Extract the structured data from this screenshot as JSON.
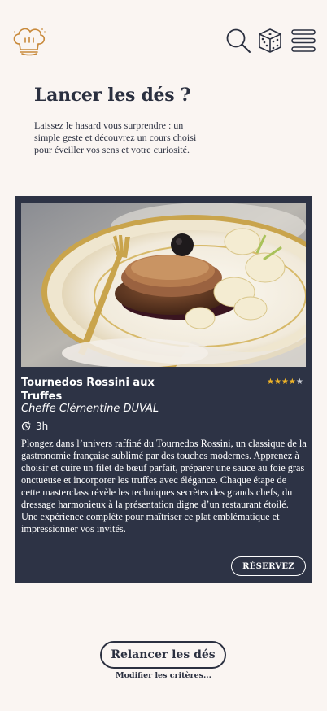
{
  "header": {
    "logo_icon": "chef-hat-icon",
    "search_icon": "search-icon",
    "dice_icon": "dice-icon",
    "menu_icon": "hamburger-menu-icon"
  },
  "page": {
    "title": "Lancer les dés ?",
    "intro": "Laissez le hasard vous surprendre : un simple geste et découvrez un cours choisi pour éveiller vos sens et votre curiosité."
  },
  "course": {
    "title_line1": "Tournedos Rossini aux",
    "title_line2": "Truffes",
    "rating": 4,
    "rating_max": 5,
    "chef": "Cheffe Clémentine DUVAL",
    "duration": "3h",
    "description": "Plongez dans l’univers raffiné du Tournedos Rossini, un classique de la gastronomie française sublimé par des touches modernes. Apprenez à choisir et cuire un filet de bœuf parfait, préparer une sauce au foie gras onctueuse et incorporer les truffes avec élégance. Chaque étape de cette masterclass révèle les techniques secrètes des grands chefs, du dressage harmonieux à la présentation digne d’un restaurant étoilé. Une expérience complète pour maîtriser ce plat emblématique et impressionner vos invités.",
    "reserve_label": "RÉSERVEZ"
  },
  "actions": {
    "relaunch_label": "Relancer les dés",
    "modify_label": "Modifier les critères..."
  },
  "colors": {
    "background": "#faf5f2",
    "card": "#2d3345",
    "text_dark": "#2b3040",
    "star": "#f0b428",
    "logo": "#c8893a"
  }
}
